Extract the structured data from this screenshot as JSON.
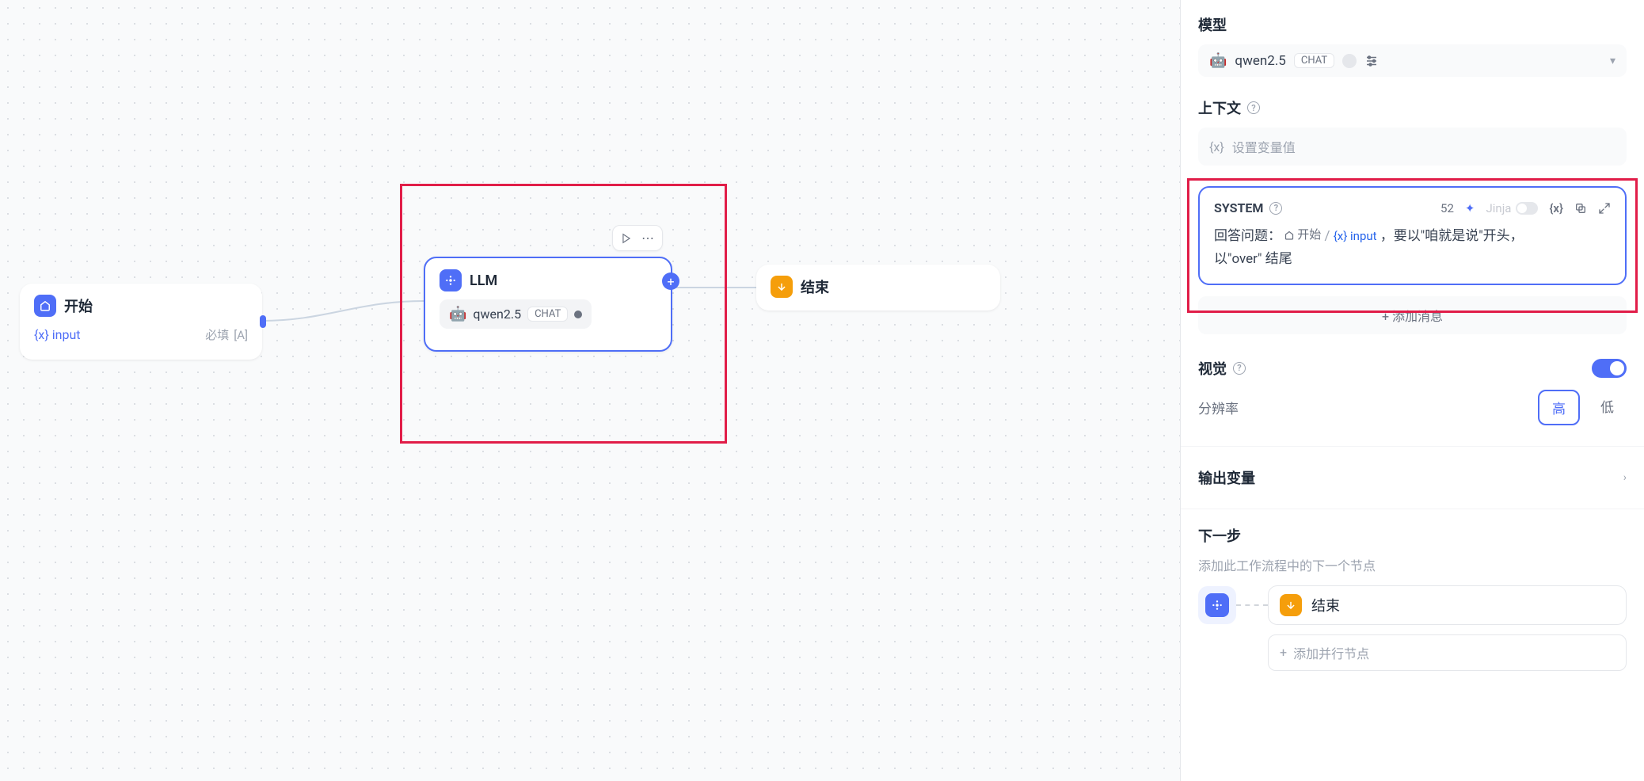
{
  "canvas": {
    "start_node": {
      "title": "开始",
      "var_prefix": "{x}",
      "var_name": "input",
      "required": "必填",
      "icon_suffix": "[A]"
    },
    "llm_node": {
      "title": "LLM",
      "model_name": "qwen2.5",
      "model_badge": "CHAT"
    },
    "end_node": {
      "title": "结束"
    }
  },
  "sidebar": {
    "model": {
      "label": "模型",
      "name": "qwen2.5",
      "badge": "CHAT"
    },
    "context": {
      "label": "上下文",
      "placeholder": "设置变量值",
      "var_prefix": "{x}"
    },
    "system": {
      "label": "SYSTEM",
      "token_count": "52",
      "jinja_label": "Jinja",
      "body_prefix": "回答问题：",
      "ref_node": "开始",
      "ref_var_prefix": "{x}",
      "ref_var": "input",
      "body_mid": " ，要以\"咱就是说\"开头，",
      "body_suffix": "以\"over\" 结尾"
    },
    "add_message": "添加消息",
    "vision": {
      "label": "视觉"
    },
    "resolution": {
      "label": "分辨率",
      "high": "高",
      "low": "低"
    },
    "output": {
      "label": "输出变量"
    },
    "next": {
      "label": "下一步",
      "subtitle": "添加此工作流程中的下一个节点",
      "end_label": "结束",
      "add_parallel": "添加并行节点"
    }
  }
}
